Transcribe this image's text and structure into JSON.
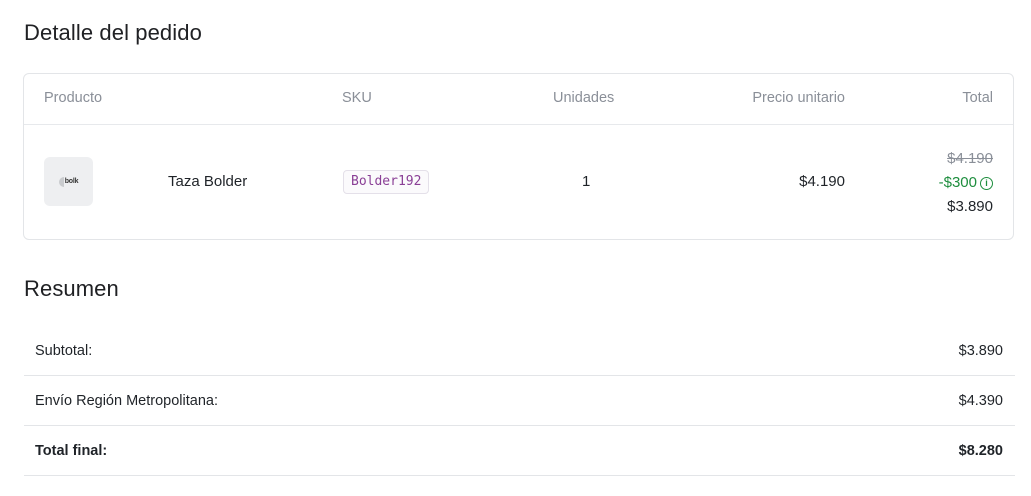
{
  "order_detail": {
    "title": "Detalle del pedido",
    "columns": {
      "product": "Producto",
      "sku": "SKU",
      "units": "Unidades",
      "unit_price": "Precio unitario",
      "total": "Total"
    },
    "items": [
      {
        "thumbnail_icon": "product-logo-icon",
        "thumbnail_text": "bolk",
        "name": "Taza Bolder",
        "sku": "Bolder192",
        "units": "1",
        "unit_price": "$4.190",
        "original_total": "$4.190",
        "discount": "-$300",
        "final_total": "$3.890"
      }
    ]
  },
  "summary": {
    "title": "Resumen",
    "subtotal_label": "Subtotal:",
    "subtotal_value": "$3.890",
    "shipping_label": "Envío Región Metropolitana:",
    "shipping_value": "$4.390",
    "total_label": "Total final:",
    "total_value": "$8.280"
  },
  "colors": {
    "discount": "#1e8e3e",
    "sku_text": "#8a3f96",
    "muted": "#8a8f98"
  }
}
